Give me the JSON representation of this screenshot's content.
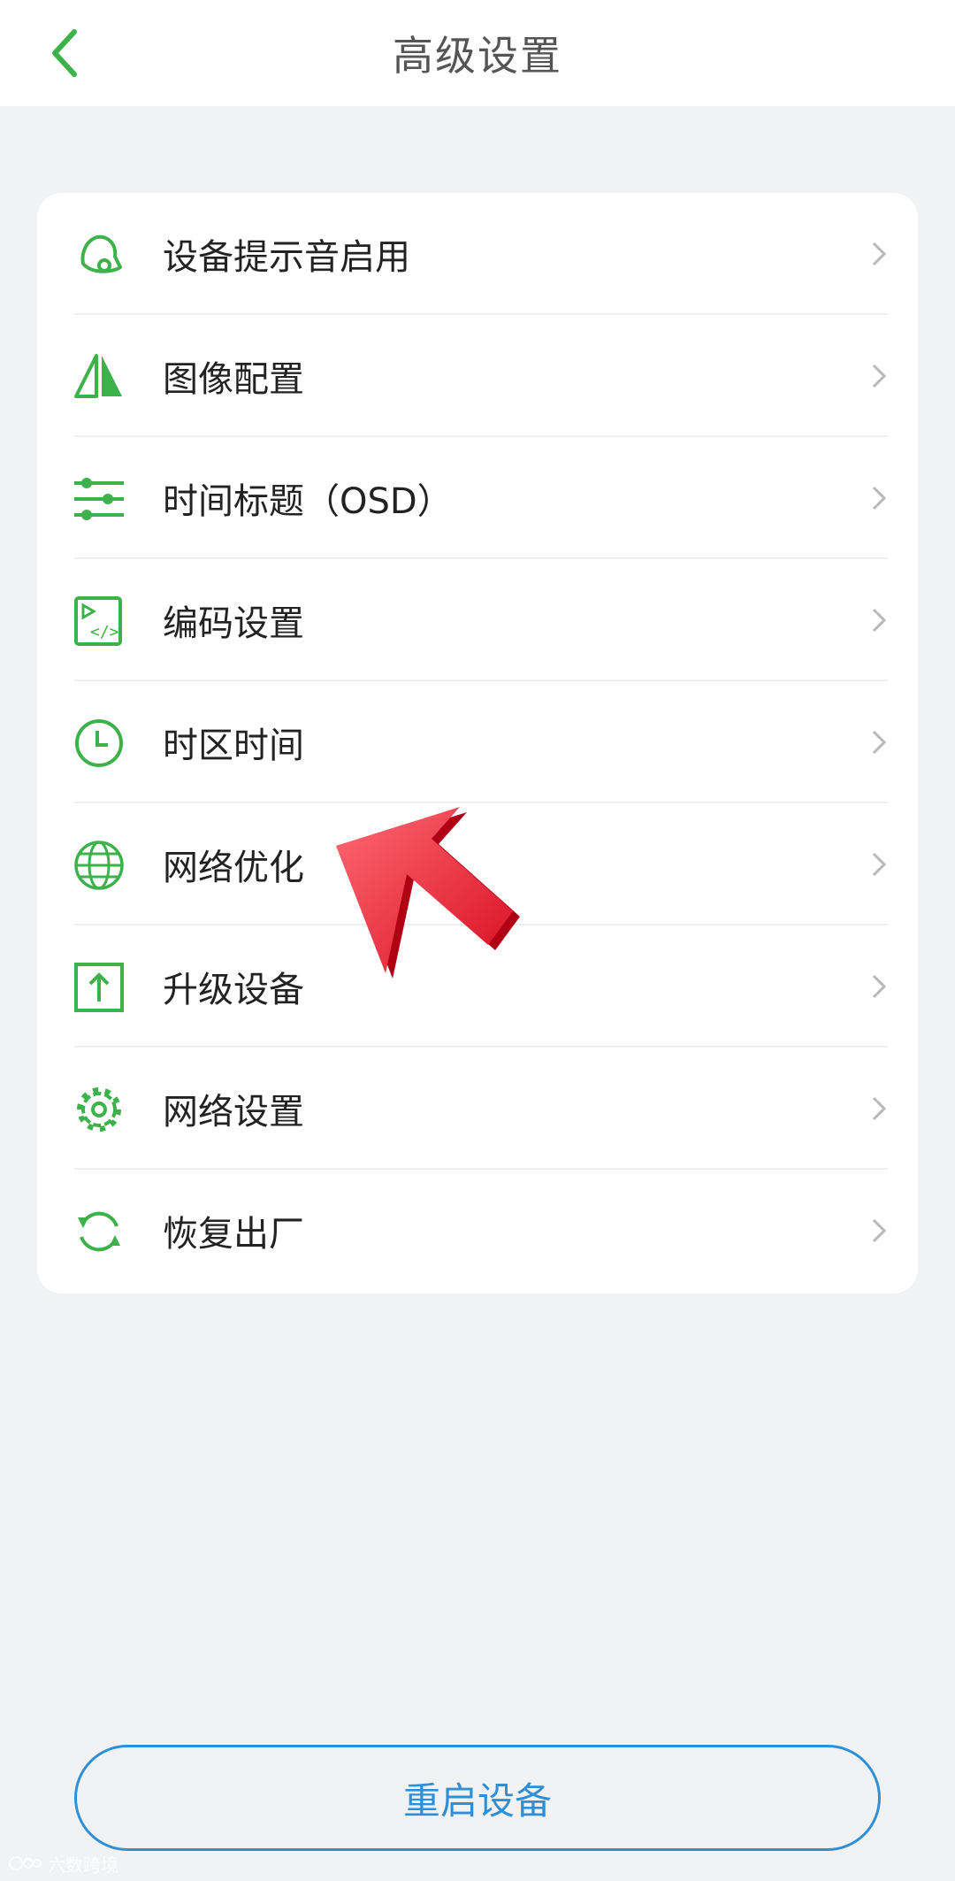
{
  "header": {
    "title": "高级设置",
    "back_icon": "chevron-left-icon"
  },
  "colors": {
    "accent_green": "#3db14a",
    "restart_blue": "#2f8fd6",
    "background": "#f1f2f4"
  },
  "settings": [
    {
      "label": "设备提示音启用",
      "icon": "bell-icon"
    },
    {
      "label": "图像配置",
      "icon": "image-triangle-icon"
    },
    {
      "label": "时间标题（OSD）",
      "icon": "sliders-icon"
    },
    {
      "label": "编码设置",
      "icon": "video-code-icon"
    },
    {
      "label": "时区时间",
      "icon": "clock-icon"
    },
    {
      "label": "网络优化",
      "icon": "globe-icon"
    },
    {
      "label": "升级设备",
      "icon": "upload-icon"
    },
    {
      "label": "网络设置",
      "icon": "gear-icon"
    },
    {
      "label": "恢复出厂",
      "icon": "refresh-icon"
    }
  ],
  "footer": {
    "restart_label": "重启设备"
  },
  "watermark": {
    "text": "六数跨境"
  }
}
